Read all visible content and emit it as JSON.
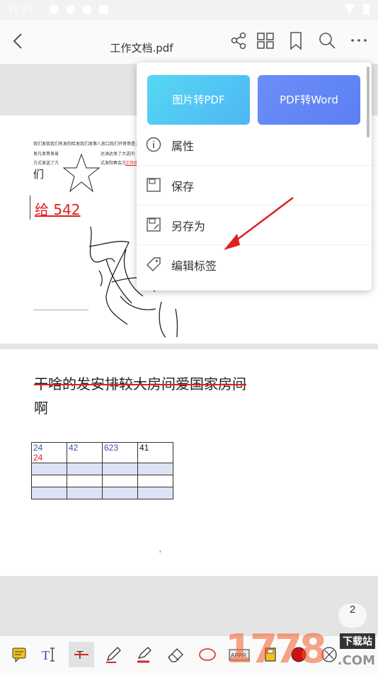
{
  "status": {
    "time": "11:19"
  },
  "header": {
    "title": "工作文档.pdf"
  },
  "page1": {
    "small_line1": "我们发我我们有发的哈发我们发第八放口我们开哥哥是大概",
    "small_line2a": "发凡发哥发省",
    "small_line2b": "达油达发了大送问",
    "small_line3a": "方式发送了方",
    "small_line3b": "式发阳奏会方",
    "small_line3c": "工作阀",
    "text_men": "们",
    "red_text": "给 542"
  },
  "page2": {
    "heading_line1": "干啥的发安排较大房间爱国家房间",
    "heading_line2": "啊",
    "table": [
      [
        "24",
        "42",
        "623",
        "41"
      ],
      [
        "",
        "",
        "",
        ""
      ],
      [
        "",
        "",
        "",
        ""
      ],
      [
        "",
        "",
        "",
        ""
      ]
    ],
    "cell_red": "24",
    "dot": "²"
  },
  "page_number": "2",
  "menu": {
    "card1": "图片转PDF",
    "card2": "PDF转Word",
    "items": [
      {
        "label": "属性",
        "icon": "info-icon"
      },
      {
        "label": "保存",
        "icon": "save-icon"
      },
      {
        "label": "另存为",
        "icon": "save-as-icon"
      },
      {
        "label": "编辑标签",
        "icon": "tag-icon"
      }
    ]
  },
  "bottom_tools": [
    "note-icon",
    "text-icon",
    "strikethrough-icon",
    "pen-icon",
    "highlighter-icon",
    "eraser-icon",
    "ellipse-icon",
    "appr-stamp-icon",
    "save-doc-icon",
    "color-icon",
    "settings-icon"
  ],
  "watermark": {
    "site": "下载站",
    "number": "1778",
    "suffix": ".COM"
  },
  "colors": {
    "accent_red": "#e02020",
    "menu_card1": "#4fc4f4",
    "menu_card2": "#6285f5",
    "table_fill": "#dde3f5"
  }
}
